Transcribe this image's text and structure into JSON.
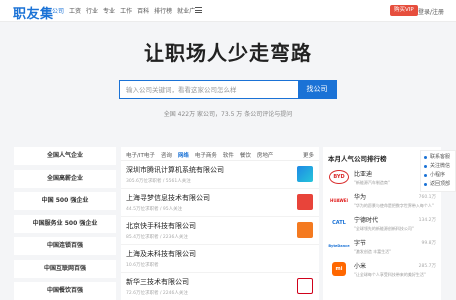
{
  "header": {
    "logo": "职友集",
    "nav": [
      "公司",
      "工资",
      "行业",
      "专业",
      "工作",
      "百科",
      "排行榜",
      "就业广"
    ],
    "nav_active": 0,
    "vip_label": "购买VIP",
    "login_label": "登录/注册"
  },
  "hero": {
    "title": "让职场人少走弯路",
    "search_placeholder": "输入公司关键词，看看这家公司怎么样",
    "search_button": "找公司",
    "stats": "全国 422万 家公司，73.5 万 条公司评论与提问"
  },
  "left_list": [
    "全国人气企业",
    "全国高薪企业",
    "中国 500 强企业",
    "中国服务业 500 强企业",
    "中国连锁百强",
    "中国互联网百强",
    "中国餐饮百强"
  ],
  "center": {
    "tabs": [
      "电子/IT电子",
      "咨询",
      "网络",
      "电子商务",
      "软件",
      "餐饮",
      "房地产",
      "更多"
    ],
    "active_tab": 2,
    "companies": [
      {
        "name": "深圳市腾讯计算机系统有限公司",
        "meta": "305.6万位求职者 / 5561人关注",
        "logo_color": "#1e88e5"
      },
      {
        "name": "上海寻梦信息技术有限公司",
        "meta": "44.5万位求职者 / 95人关注",
        "logo_color": "#e8443a"
      },
      {
        "name": "北京快手科技有限公司",
        "meta": "85.4万位求职者 / 2236人关注",
        "logo_color": "#f47a20"
      },
      {
        "name": "上海及未科技有限公司",
        "meta": "10.6万位求职者",
        "logo_color": "#ffffff"
      },
      {
        "name": "新华三技术有限公司",
        "meta": "72.6万位求职者 / 2246人关注",
        "logo_color": "#d0021b"
      }
    ]
  },
  "right_panel": {
    "title": "本月人气公司排行榜",
    "ranks": [
      {
        "name": "比亚迪",
        "desc": "\"新能源汽车制造商\"",
        "score": "",
        "logo": "BYD",
        "color": "#d92b2b"
      },
      {
        "name": "华为",
        "desc": "\"华为的愿景与使命是把数字世界带入每个人\"",
        "score": "760.1万",
        "logo": "HUAWEI",
        "color": "#e02020"
      },
      {
        "name": "宁德时代",
        "desc": "\"全球领先的新能源创新科技公司\"",
        "score": "134.2万",
        "logo": "CATL",
        "color": "#1a72d6"
      },
      {
        "name": "字节",
        "desc": "\"激发创造 丰富生活\"",
        "score": "99.8万",
        "logo": "ByteDance",
        "color": "#1a72d6"
      },
      {
        "name": "小米",
        "desc": "\"让全球每个人享受科技带来的美好生活\"",
        "score": "285.7万",
        "logo": "mi",
        "color": "#ff6700"
      }
    ]
  },
  "side_tools": [
    "联系客服",
    "关注微信",
    "小程序",
    "返回顶部"
  ]
}
